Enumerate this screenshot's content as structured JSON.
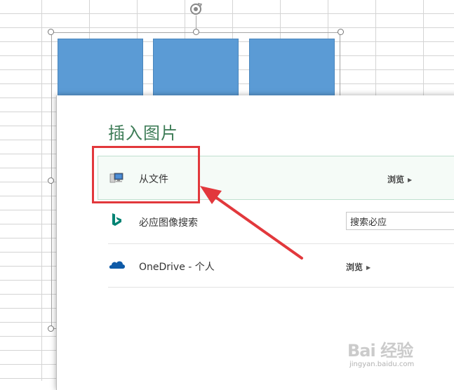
{
  "dialog": {
    "title": "插入图片",
    "rows": [
      {
        "icon": "computer-icon",
        "label": "从文件",
        "action": "浏览"
      },
      {
        "icon": "bing-icon",
        "label": "必应图像搜索",
        "search_value": "搜索必应"
      },
      {
        "icon": "onedrive-icon",
        "label": "OneDrive - 个人",
        "action": "浏览"
      }
    ]
  },
  "colors": {
    "bar_fill": "#5b9bd5",
    "title_green": "#3f7d58",
    "annotation_red": "#e2383c",
    "bing_teal": "#008373",
    "onedrive_blue": "#0e5aa7"
  },
  "watermark": {
    "main": "Bai 经验",
    "sub": "jingyan.baidu.com"
  }
}
